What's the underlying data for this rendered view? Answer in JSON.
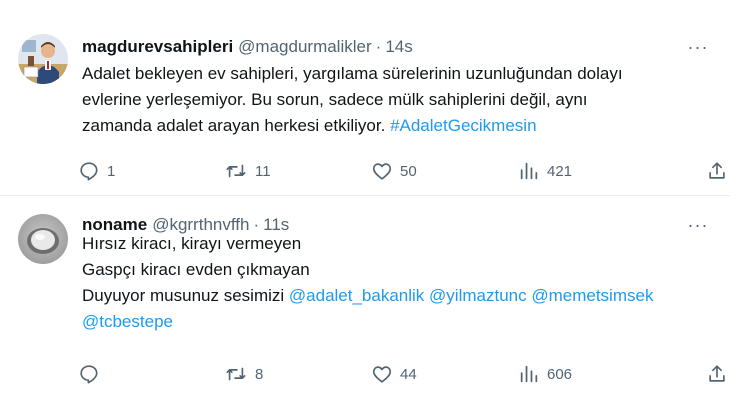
{
  "tweets": [
    {
      "display_name": "magdurevsahipleri",
      "handle": "@magdurmalikler",
      "separator": "·",
      "time": "14s",
      "more": "···",
      "lines": [
        [
          {
            "text": "Adalet bekleyen ev sahipleri, yargılama sürelerinin uzunluğundan dolayı"
          }
        ],
        [
          {
            "text": "evlerine yerleşemiyor. Bu sorun, sadece mülk sahiplerini değil, aynı"
          }
        ],
        [
          {
            "text": "zamanda adalet arayan herkesi etkiliyor. "
          },
          {
            "text": "#AdaletGecikmesin",
            "link": true
          }
        ]
      ],
      "replies": "1",
      "retweets": "11",
      "likes": "50",
      "views": "421"
    },
    {
      "display_name": "noname",
      "handle": "@kgrrthnvffh",
      "separator": "·",
      "time": "11s",
      "more": "···",
      "lines": [
        [
          {
            "text": "Hırsız kiracı, kirayı vermeyen"
          }
        ],
        [
          {
            "text": "Gaspçı kiracı evden çıkmayan"
          }
        ],
        [
          {
            "text": "Duyuyor musunuz sesimizi "
          },
          {
            "text": "@adalet_bakanlik",
            "link": true
          },
          {
            "text": " "
          },
          {
            "text": "@yilmaztunc",
            "link": true
          },
          {
            "text": " "
          },
          {
            "text": "@memetsimsek",
            "link": true
          }
        ],
        [
          {
            "text": "@tcbestepe",
            "link": true
          }
        ]
      ],
      "replies": "",
      "retweets": "8",
      "likes": "44",
      "views": "606"
    }
  ],
  "colors": {
    "text": "#0f1419",
    "muted": "#536471",
    "link": "#1d9bf0",
    "divider": "#e6ecf0"
  },
  "icons": [
    "reply-icon",
    "retweet-icon",
    "like-icon",
    "views-icon",
    "share-icon",
    "more-icon"
  ]
}
